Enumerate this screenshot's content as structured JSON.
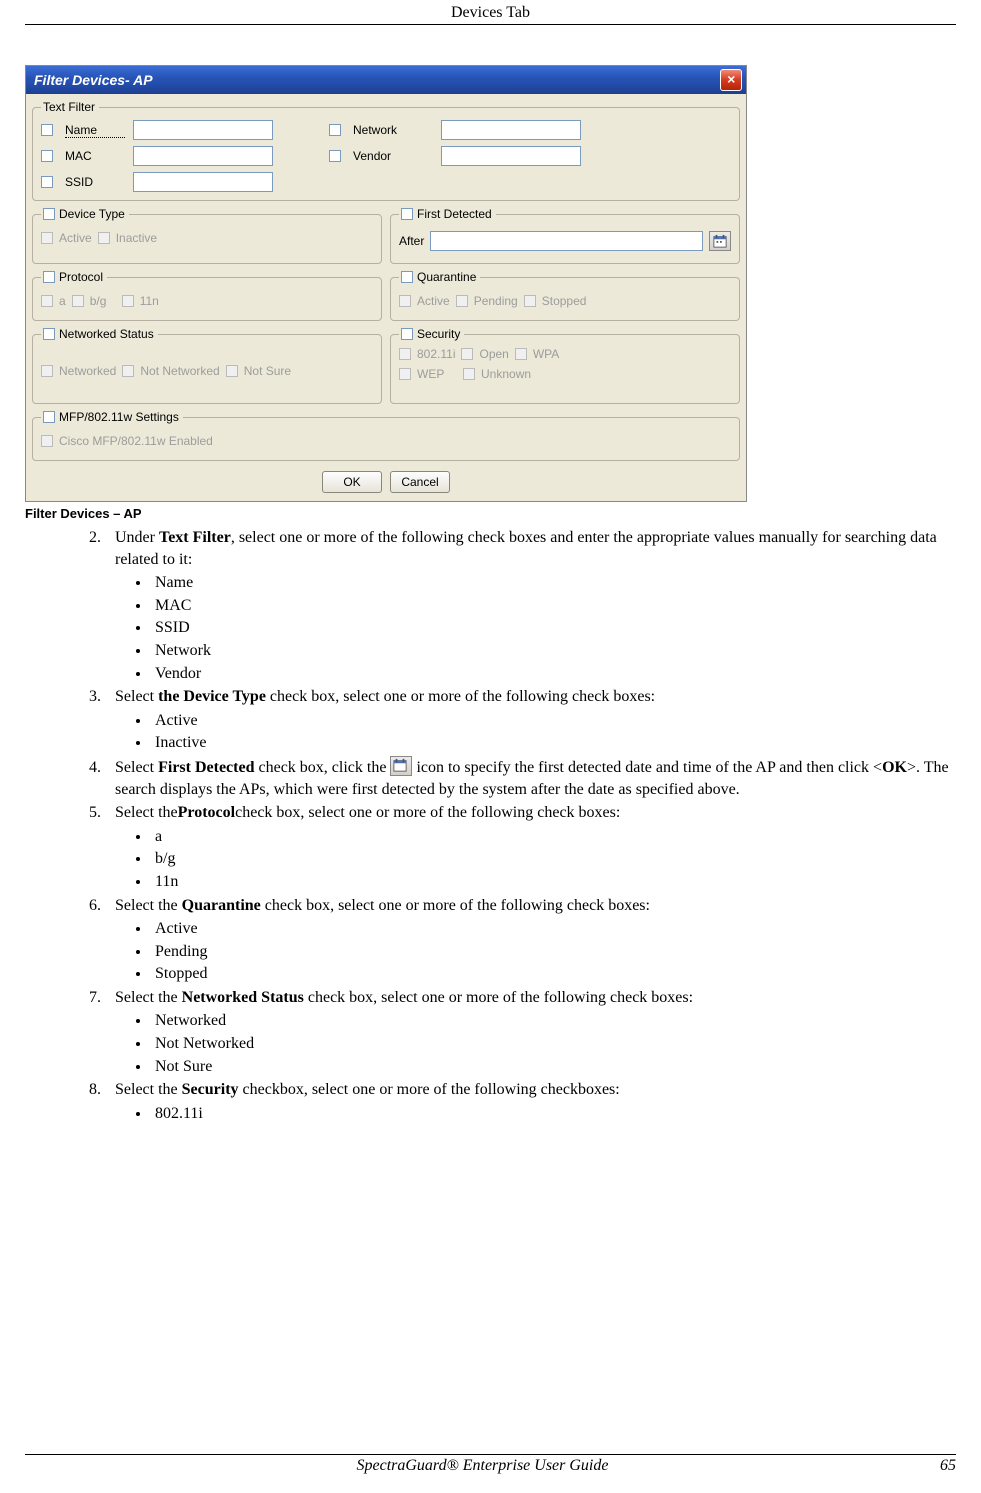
{
  "header": {
    "title": "Devices Tab"
  },
  "dialog": {
    "title": "Filter Devices- AP",
    "textFilter": {
      "legend": "Text Filter",
      "name": "Name",
      "mac": "MAC",
      "ssid": "SSID",
      "network": "Network",
      "vendor": "Vendor"
    },
    "deviceType": {
      "legend": "Device Type",
      "active": "Active",
      "inactive": "Inactive"
    },
    "firstDetected": {
      "legend": "First Detected",
      "after": "After"
    },
    "protocol": {
      "legend": "Protocol",
      "a": "a",
      "bg": "b/g",
      "n11": "11n"
    },
    "quarantine": {
      "legend": "Quarantine",
      "active": "Active",
      "pending": "Pending",
      "stopped": "Stopped"
    },
    "netStatus": {
      "legend": "Networked Status",
      "networked": "Networked",
      "notnet": "Not Networked",
      "notsure": "Not Sure"
    },
    "security": {
      "legend": "Security",
      "i80211": "802.11i",
      "open": "Open",
      "wpa": "WPA",
      "wep": "WEP",
      "unknown": "Unknown"
    },
    "mfp": {
      "legend": "MFP/802.11w Settings",
      "cisco": "Cisco MFP/802.11w Enabled"
    },
    "buttons": {
      "ok": "OK",
      "cancel": "Cancel"
    }
  },
  "caption": "Filter Devices – AP",
  "steps": {
    "s2a": "Under ",
    "s2b": "Text Filter",
    "s2c": ", select one or more of the following check boxes and enter the appropriate values manually for searching data related to it:",
    "s2_items": {
      "i1": "Name",
      "i2": "MAC",
      "i3": "SSID",
      "i4": "Network",
      "i5": "Vendor"
    },
    "s3a": "Select ",
    "s3b": "the Device Type",
    "s3c": " check box, select one or more of the following check boxes:",
    "s3_items": {
      "i1": "Active",
      "i2": "Inactive"
    },
    "s4a": "Select ",
    "s4b": "First Detected",
    "s4c": " check box, click the ",
    "s4d": " icon to specify the first detected date and time of the AP and then click <",
    "s4e": "OK",
    "s4f": ">. The search displays the APs, which were first detected by the system after the date as specified above.",
    "s5a": "Select the",
    "s5b": "Protocol",
    "s5c": "check box, select one or more of the following check boxes:",
    "s5_items": {
      "i1": "a",
      "i2": "b/g",
      "i3": "11n"
    },
    "s6a": "Select the ",
    "s6b": "Quarantine",
    "s6c": " check box, select one or more of the following check boxes:",
    "s6_items": {
      "i1": "Active",
      "i2": "Pending",
      "i3": "Stopped"
    },
    "s7a": "Select the ",
    "s7b": "Networked Status",
    "s7c": " check box, select one or more of the following check boxes:",
    "s7_items": {
      "i1": "Networked",
      "i2": "Not Networked",
      "i3": "Not Sure"
    },
    "s8a": "Select the ",
    "s8b": "Security",
    "s8c": " checkbox, select one or more of the following checkboxes:",
    "s8_items": {
      "i1": "802.11i"
    }
  },
  "footer": {
    "guide": "SpectraGuard®  Enterprise User Guide",
    "page": "65"
  }
}
